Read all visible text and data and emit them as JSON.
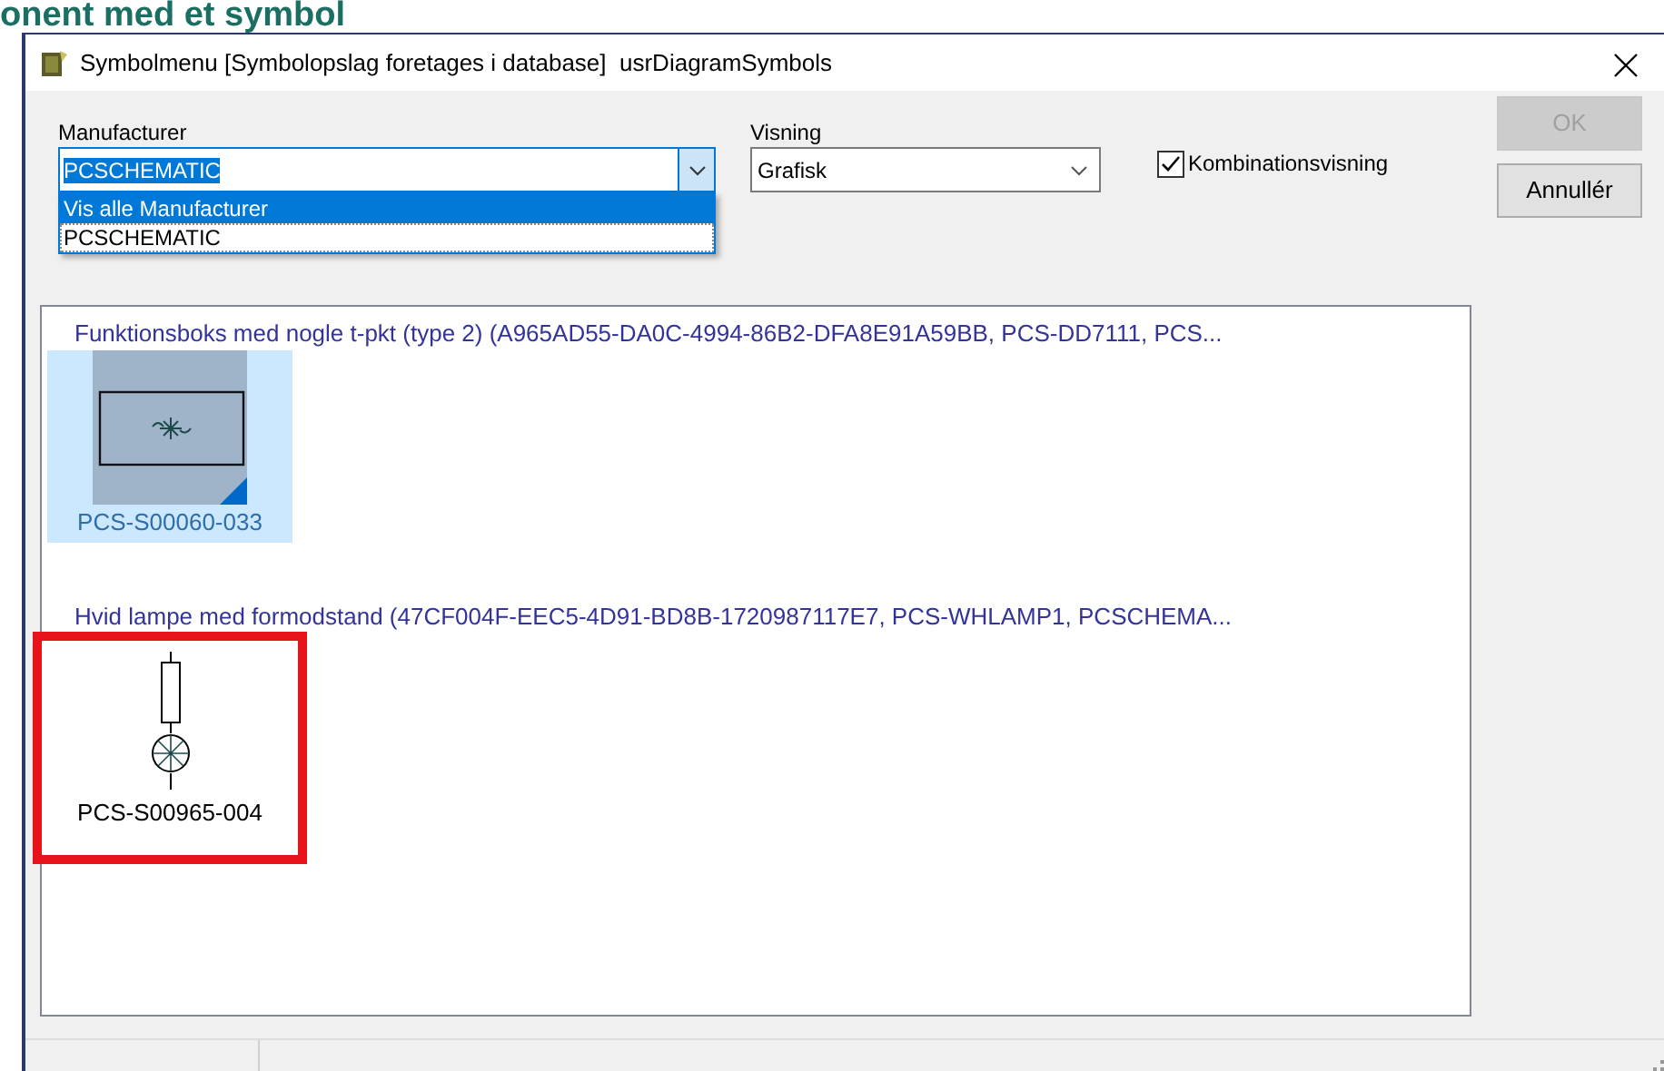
{
  "heading": "onent med et symbol",
  "window": {
    "title": "Symbolmenu [Symbolopslag foretages i database]  usrDiagramSymbols"
  },
  "manufacturer": {
    "label": "Manufacturer",
    "value": "PCSCHEMATIC",
    "expanded": true,
    "options": [
      {
        "label": "Vis alle Manufacturer",
        "selected": false,
        "highlighted": true
      },
      {
        "label": "PCSCHEMATIC",
        "selected": true,
        "highlighted": false
      }
    ]
  },
  "visning": {
    "label": "Visning",
    "value": "Grafisk"
  },
  "kombinationsvisning": {
    "label": "Kombinationsvisning",
    "checked": true
  },
  "buttons": [
    {
      "label": "OK",
      "disabled": true
    },
    {
      "label": "Annullér",
      "disabled": false
    }
  ],
  "groups": [
    {
      "title": "Funktionsboks med nogle t-pkt (type 2) (A965AD55-DA0C-4994-86B2-DFA8E91A59BB, PCS-DD7111, PCS...",
      "items": [
        {
          "kind": "function-box",
          "label": "PCS-S00060-033",
          "selected": true,
          "marked": false
        }
      ]
    },
    {
      "title": "Hvid lampe med formodstand (47CF004F-EEC5-4D91-BD8B-1720987117E7, PCS-WHLAMP1, PCSCHEMA...",
      "items": [
        {
          "kind": "lamp",
          "label": "PCS-S00965-004",
          "selected": false,
          "marked": true
        }
      ]
    }
  ]
}
